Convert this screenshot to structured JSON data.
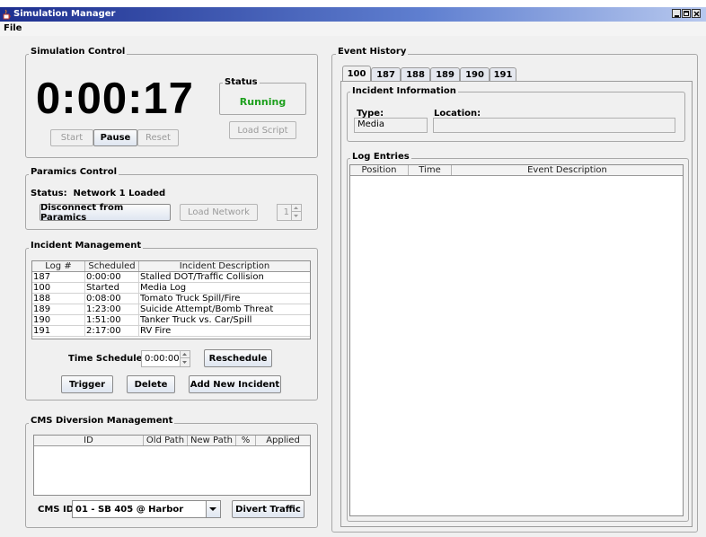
{
  "window": {
    "title": "Simulation Manager",
    "icon": "java-cup-icon"
  },
  "menu": {
    "file": "File"
  },
  "simulation_control": {
    "title": "Simulation Control",
    "clock": "0:00:17",
    "status_title": "Status",
    "status_value": "Running",
    "status_color": "#1ea01e",
    "start": "Start",
    "pause": "Pause",
    "reset": "Reset",
    "load_script": "Load Script"
  },
  "paramics_control": {
    "title": "Paramics Control",
    "status_text": "Status:  Network 1 Loaded",
    "disconnect": "Disconnect from Paramics",
    "load_network": "Load Network",
    "spinner_value": "1"
  },
  "incident_management": {
    "title": "Incident Management",
    "columns": [
      "Log #",
      "Scheduled",
      "Incident Description"
    ],
    "rows": [
      [
        "187",
        "0:00:00",
        "Stalled DOT/Traffic Collision"
      ],
      [
        "100",
        "Started",
        "Media Log"
      ],
      [
        "188",
        "0:08:00",
        "Tomato Truck Spill/Fire"
      ],
      [
        "189",
        "1:23:00",
        "Suicide Attempt/Bomb Threat"
      ],
      [
        "190",
        "1:51:00",
        "Tanker Truck vs. Car/Spill"
      ],
      [
        "191",
        "2:17:00",
        "RV Fire"
      ]
    ],
    "time_scheduled_label": "Time Scheduled:",
    "time_scheduled_value": "0:00:00",
    "reschedule": "Reschedule",
    "trigger": "Trigger",
    "delete": "Delete",
    "add_new": "Add New Incident"
  },
  "cms": {
    "title": "CMS Diversion Management",
    "columns": [
      "ID",
      "Old Path",
      "New Path",
      "%",
      "Applied"
    ],
    "cms_id_label": "CMS ID:",
    "cms_id_value": "01 - SB 405 @ Harbor",
    "divert": "Divert Traffic"
  },
  "event_history": {
    "title": "Event History",
    "tabs": [
      "100",
      "187",
      "188",
      "189",
      "190",
      "191"
    ],
    "active_tab": "100",
    "incident_info_title": "Incident Information",
    "type_label": "Type:",
    "type_value": "Media",
    "location_label": "Location:",
    "location_value": "",
    "log_entries_title": "Log Entries",
    "log_columns": [
      "Position",
      "Time",
      "Event Description"
    ]
  }
}
